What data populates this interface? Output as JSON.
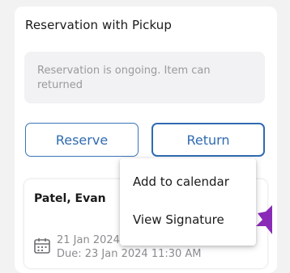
{
  "section": {
    "title": "Reservation with Pickup",
    "status_message": "Reservation is ongoing. Item can returned"
  },
  "actions": {
    "reserve_label": "Reserve",
    "return_label": "Return"
  },
  "reservation": {
    "name": "Patel, Evan",
    "start_date": "21 Jan 2024",
    "due_date": "Due: 23 Jan 2024 11:30 AM",
    "icon": "calendar-icon"
  },
  "menu": {
    "items": [
      {
        "label": "Add to calendar"
      },
      {
        "label": "View Signature"
      }
    ]
  },
  "colors": {
    "accent": "#2f6bb0",
    "badge": "#8a2bb8"
  }
}
